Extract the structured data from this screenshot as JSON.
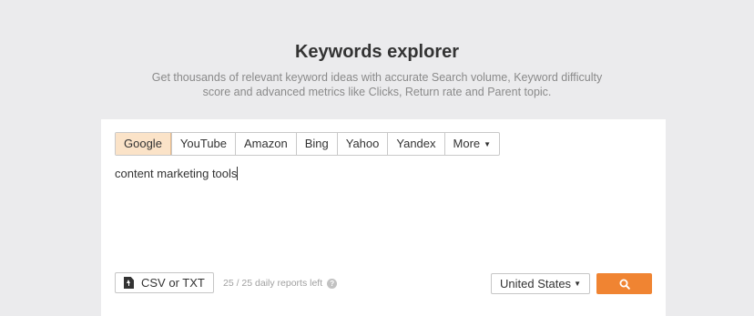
{
  "page": {
    "title": "Keywords explorer",
    "subtitle": "Get thousands of relevant keyword ideas with accurate Search volume, Keyword difficulty score and advanced metrics like Clicks, Return rate and Parent topic."
  },
  "search_engines": {
    "items": [
      "Google",
      "YouTube",
      "Amazon",
      "Bing",
      "Yahoo",
      "Yandex"
    ],
    "more_label": "More",
    "active": "Google"
  },
  "query": {
    "value": "content marketing tools"
  },
  "footer": {
    "upload_label": "CSV or TXT",
    "reports_left": "25 / 25 daily reports left",
    "help_glyph": "?",
    "country": "United States"
  },
  "colors": {
    "accent": "#f08432",
    "active_tab_bg": "#fbe3c8",
    "page_bg": "#ebebed"
  },
  "icons": {
    "upload": "file-upload-icon",
    "search": "search-icon",
    "help": "help-icon",
    "dropdown": "caret-down-icon"
  }
}
